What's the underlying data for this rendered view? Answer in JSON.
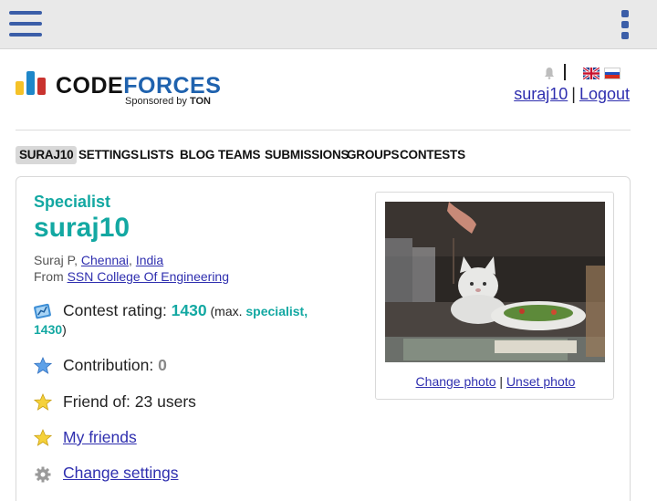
{
  "topbar": {
    "menu_icon": "hamburger-menu-icon",
    "more_icon": "kebab-more-icon"
  },
  "logo": {
    "word_part1": "CODE",
    "word_part2": "FORCES",
    "sponsor_prefix": "Sponsored by ",
    "sponsor_name": "TON"
  },
  "header": {
    "username_link": "suraj10",
    "separator": "|",
    "logout_link": "Logout"
  },
  "nav": {
    "tabs": [
      {
        "label": "SURAJ10"
      },
      {
        "label": "SETTINGS"
      },
      {
        "label": "LISTS"
      },
      {
        "label": "BLOG"
      },
      {
        "label": "TEAMS"
      },
      {
        "label": "SUBMISSIONS"
      },
      {
        "label": "GROUPS"
      },
      {
        "label": "CONTESTS"
      }
    ]
  },
  "profile": {
    "rank": "Specialist",
    "handle": "suraj10",
    "name_prefix": "Suraj P, ",
    "city": "Chennai",
    "comma": ", ",
    "country": "India",
    "from_prefix": "From ",
    "organization": "SSN College Of Engineering",
    "rating_label": "Contest rating: ",
    "rating_value": "1430",
    "max_prefix": " (max. ",
    "max_rank": "specialist,",
    "max_value": "1430",
    "max_suffix": ")",
    "contribution_label": "Contribution: ",
    "contribution_value": "0",
    "friend_of": "Friend of: 23 users",
    "my_friends": "My friends",
    "change_settings": "Change settings",
    "change_photo": "Change photo",
    "photo_sep": " | ",
    "unset_photo": "Unset photo"
  },
  "colors": {
    "specialist": "#13a8a2",
    "link": "#2f2faf",
    "topbar_icon": "#3b5ea8"
  }
}
